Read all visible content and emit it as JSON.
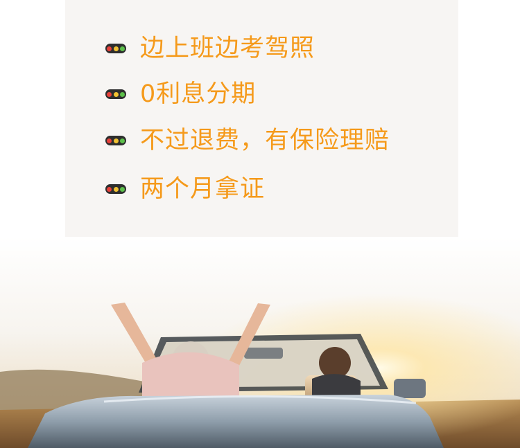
{
  "features": [
    {
      "text": "边上班边考驾照",
      "icon": "traffic-light-icon"
    },
    {
      "text": "0利息分期",
      "icon": "traffic-light-icon"
    },
    {
      "text": "不过退费，有保险理赔",
      "icon": "traffic-light-icon"
    },
    {
      "text": "两个月拿证",
      "icon": "traffic-light-icon"
    }
  ],
  "colors": {
    "accent": "#f59a1b",
    "card_bg": "#f7f5f3",
    "light_red": "#e8403a",
    "light_yellow": "#f1c232",
    "light_green": "#5cbf4a"
  }
}
